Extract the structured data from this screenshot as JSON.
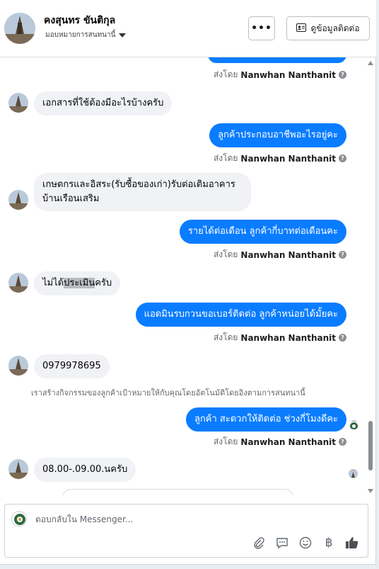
{
  "header": {
    "title": "คงสุนทร ขันติกุล",
    "subtitle": "มอบหมายการสนทนานี้",
    "more_label": "•••",
    "view_info_label": "ดูข้อมูลติดต่อ"
  },
  "messages": {
    "sent_prefix": "ส่งโดย",
    "agent_name": "Nanwhan Nanthanit",
    "in1": "เอกสารที่ใช้ต้องมีอะไรบ้างครับ",
    "out1": "ลูกค้าประกอบอาชีพอะไรอยู่คะ",
    "in2_line1": "เกษตกรและอิสระ(รับซื้อของเก่า)รับต่อเติมอาคาร",
    "in2_line2": "บ้านเรือนเสริม",
    "out2": "รายได้ต่อเดือน ลูกค้ากี่บาทต่อเดือนคะ",
    "in3_a": "ไม่ได้",
    "in3_b": "ประเมิน",
    "in3_c": "ครับ",
    "out3": "แอดมินรบกวนขอเบอร์ติดต่อ ลูกค้าหน่อยได้มั้ยคะ",
    "in4": "0979978695",
    "system_note": "เราสร้างกิจกรรมของลูกค้าเป้าหมายให้กับคุณโดยอัตโนมัติโดยอิงตามการสนทนานี้",
    "out4": "ลูกค้า สะดวกให้ติดต่อ ช่วงกี่โมงดีคะ",
    "in5": "08.00-.09.00.นครับ"
  },
  "composer": {
    "placeholder": "ตอบกลับใน Messenger..."
  },
  "icons": [
    "ellipsis-icon",
    "contact-card-icon",
    "caret-down-icon",
    "question-icon",
    "attachment-icon",
    "saved-reply-icon",
    "emoji-icon",
    "baht-icon",
    "thumbs-up-icon"
  ],
  "colors": {
    "outgoing_bubble": "#0a7cff",
    "incoming_bubble": "#f0f2f5"
  }
}
